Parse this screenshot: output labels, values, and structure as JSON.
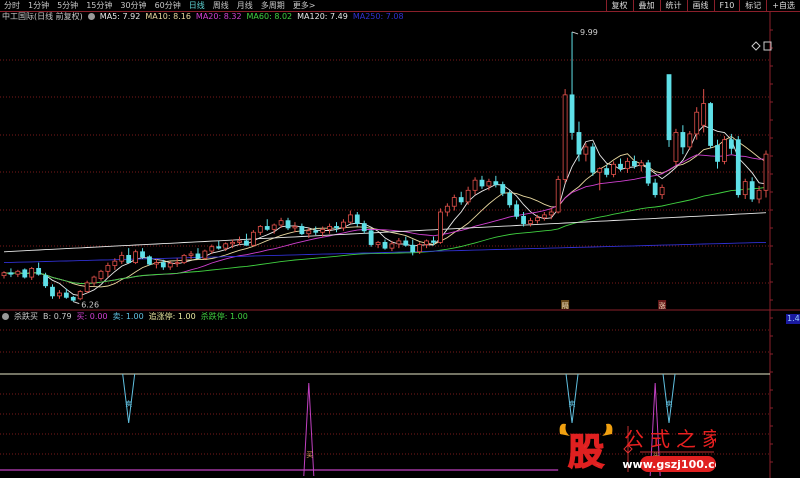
{
  "tabs": [
    "分时",
    "1分钟",
    "5分钟",
    "15分钟",
    "30分钟",
    "60分钟",
    "日线",
    "周线",
    "月线",
    "多周期",
    "更多>"
  ],
  "active_tab": "日线",
  "right_buttons": [
    "复权",
    "叠加",
    "统计",
    "画线",
    "F10",
    "标记",
    "+自选"
  ],
  "main": {
    "title": "中工国际(日线 前复权)",
    "ma": [
      {
        "label": "MA5: 7.92",
        "color": "#e8e8e8"
      },
      {
        "label": "MA10: 8.16",
        "color": "#e8d8a0"
      },
      {
        "label": "MA20: 8.32",
        "color": "#d040d0"
      },
      {
        "label": "MA60: 8.02",
        "color": "#40d040"
      },
      {
        "label": "MA120: 7.49",
        "color": "#e8e8e8"
      },
      {
        "label": "MA250: 7.08",
        "color": "#3030d0"
      }
    ],
    "high_label": "9.99",
    "low_label": "6.26",
    "markers": [
      {
        "bar": 81,
        "text": "隔"
      },
      {
        "bar": 95,
        "text": "涨"
      }
    ]
  },
  "indicator": {
    "name": "杀跌买",
    "values": [
      {
        "label": "B: 0.79",
        "color": "#c8c8c8"
      },
      {
        "label": "买: 0.00",
        "color": "#d040d0"
      },
      {
        "label": "卖: 1.00",
        "color": "#60c0e0"
      },
      {
        "label": "追涨停: 1.00",
        "color": "#e8e8a0"
      },
      {
        "label": "杀跌停: 1.00",
        "color": "#40d040"
      }
    ],
    "axis_label": "1.4",
    "sell_bars": [
      18,
      82,
      96
    ],
    "buy_bars": [
      44,
      94
    ],
    "sell_text": "卖",
    "buy_text": "买"
  },
  "colors": {
    "up": "#e0504a",
    "down": "#5fe0e8",
    "grid": "#7a1a1a",
    "bg": "#000000"
  },
  "watermark": {
    "logo": "股",
    "name": "公式之家",
    "url": "www.gszj100.com"
  },
  "chart_data": {
    "type": "candlestick",
    "ylim": [
      6.2,
      10.1
    ],
    "ohlc": [
      [
        6.62,
        6.68,
        6.58,
        6.66
      ],
      [
        6.66,
        6.72,
        6.6,
        6.64
      ],
      [
        6.64,
        6.7,
        6.6,
        6.68
      ],
      [
        6.7,
        6.72,
        6.58,
        6.6
      ],
      [
        6.6,
        6.74,
        6.56,
        6.72
      ],
      [
        6.72,
        6.8,
        6.62,
        6.64
      ],
      [
        6.62,
        6.66,
        6.45,
        6.48
      ],
      [
        6.46,
        6.5,
        6.3,
        6.34
      ],
      [
        6.34,
        6.42,
        6.3,
        6.38
      ],
      [
        6.38,
        6.44,
        6.3,
        6.32
      ],
      [
        6.32,
        6.34,
        6.26,
        6.28
      ],
      [
        6.3,
        6.42,
        6.28,
        6.4
      ],
      [
        6.4,
        6.55,
        6.38,
        6.52
      ],
      [
        6.52,
        6.62,
        6.48,
        6.6
      ],
      [
        6.58,
        6.7,
        6.55,
        6.68
      ],
      [
        6.68,
        6.8,
        6.6,
        6.76
      ],
      [
        6.76,
        6.86,
        6.7,
        6.82
      ],
      [
        6.82,
        6.95,
        6.78,
        6.9
      ],
      [
        6.9,
        7.0,
        6.85,
        6.8
      ],
      [
        6.8,
        6.98,
        6.78,
        6.95
      ],
      [
        6.95,
        7.0,
        6.85,
        6.88
      ],
      [
        6.88,
        6.9,
        6.76,
        6.78
      ],
      [
        6.78,
        6.85,
        6.72,
        6.8
      ],
      [
        6.8,
        6.84,
        6.7,
        6.74
      ],
      [
        6.74,
        6.82,
        6.7,
        6.79
      ],
      [
        6.79,
        6.86,
        6.74,
        6.8
      ],
      [
        6.8,
        6.92,
        6.78,
        6.9
      ],
      [
        6.9,
        6.96,
        6.85,
        6.92
      ],
      [
        6.92,
        7.0,
        6.88,
        6.86
      ],
      [
        6.86,
        6.98,
        6.84,
        6.96
      ],
      [
        6.96,
        7.05,
        6.92,
        7.02
      ],
      [
        7.02,
        7.1,
        6.98,
        7.0
      ],
      [
        7.0,
        7.08,
        6.96,
        7.06
      ],
      [
        7.06,
        7.12,
        7.0,
        7.08
      ],
      [
        7.08,
        7.16,
        7.04,
        7.1
      ],
      [
        7.1,
        7.2,
        7.06,
        7.04
      ],
      [
        7.04,
        7.25,
        7.02,
        7.22
      ],
      [
        7.22,
        7.32,
        7.18,
        7.3
      ],
      [
        7.3,
        7.4,
        7.24,
        7.26
      ],
      [
        7.26,
        7.34,
        7.2,
        7.32
      ],
      [
        7.32,
        7.42,
        7.28,
        7.38
      ],
      [
        7.38,
        7.42,
        7.25,
        7.28
      ],
      [
        7.28,
        7.36,
        7.22,
        7.3
      ],
      [
        7.3,
        7.34,
        7.18,
        7.2
      ],
      [
        7.2,
        7.28,
        7.14,
        7.24
      ],
      [
        7.24,
        7.3,
        7.18,
        7.22
      ],
      [
        7.22,
        7.3,
        7.16,
        7.26
      ],
      [
        7.26,
        7.34,
        7.2,
        7.3
      ],
      [
        7.3,
        7.36,
        7.22,
        7.28
      ],
      [
        7.28,
        7.4,
        7.24,
        7.36
      ],
      [
        7.36,
        7.52,
        7.34,
        7.46
      ],
      [
        7.46,
        7.5,
        7.3,
        7.34
      ],
      [
        7.34,
        7.38,
        7.2,
        7.24
      ],
      [
        7.24,
        7.26,
        7.02,
        7.05
      ],
      [
        7.05,
        7.1,
        7.0,
        7.08
      ],
      [
        7.08,
        7.12,
        6.98,
        7.0
      ],
      [
        7.0,
        7.1,
        6.96,
        7.06
      ],
      [
        7.06,
        7.14,
        7.0,
        7.1
      ],
      [
        7.1,
        7.16,
        7.02,
        7.04
      ],
      [
        7.04,
        7.12,
        6.9,
        6.95
      ],
      [
        6.95,
        7.08,
        6.92,
        7.05
      ],
      [
        7.05,
        7.12,
        7.0,
        7.1
      ],
      [
        7.1,
        7.16,
        7.04,
        7.08
      ],
      [
        7.08,
        7.55,
        7.06,
        7.5
      ],
      [
        7.5,
        7.62,
        7.44,
        7.58
      ],
      [
        7.58,
        7.74,
        7.52,
        7.7
      ],
      [
        7.7,
        7.78,
        7.6,
        7.64
      ],
      [
        7.64,
        7.85,
        7.6,
        7.8
      ],
      [
        7.8,
        7.98,
        7.74,
        7.94
      ],
      [
        7.94,
        8.0,
        7.82,
        7.86
      ],
      [
        7.86,
        7.96,
        7.8,
        7.92
      ],
      [
        7.92,
        8.0,
        7.84,
        7.88
      ],
      [
        7.88,
        7.92,
        7.72,
        7.76
      ],
      [
        7.76,
        7.8,
        7.56,
        7.6
      ],
      [
        7.6,
        7.66,
        7.4,
        7.44
      ],
      [
        7.44,
        7.5,
        7.3,
        7.34
      ],
      [
        7.34,
        7.42,
        7.3,
        7.38
      ],
      [
        7.38,
        7.46,
        7.34,
        7.42
      ],
      [
        7.42,
        7.5,
        7.38,
        7.46
      ],
      [
        7.46,
        7.55,
        7.4,
        7.5
      ],
      [
        7.5,
        8.0,
        7.48,
        7.95
      ],
      [
        7.95,
        9.2,
        7.9,
        9.12
      ],
      [
        9.12,
        9.99,
        8.5,
        8.6
      ],
      [
        8.6,
        8.75,
        8.2,
        8.3
      ],
      [
        8.3,
        8.45,
        8.2,
        8.4
      ],
      [
        8.4,
        8.45,
        8.0,
        8.05
      ],
      [
        8.05,
        8.12,
        7.8,
        8.1
      ],
      [
        8.1,
        8.15,
        7.98,
        8.02
      ],
      [
        8.02,
        8.2,
        7.98,
        8.16
      ],
      [
        8.16,
        8.24,
        8.06,
        8.1
      ],
      [
        8.1,
        8.25,
        8.04,
        8.2
      ],
      [
        8.2,
        8.28,
        8.1,
        8.14
      ],
      [
        8.14,
        8.22,
        8.06,
        8.18
      ],
      [
        8.18,
        8.22,
        7.86,
        7.9
      ],
      [
        7.9,
        7.96,
        7.7,
        7.74
      ],
      [
        7.74,
        7.88,
        7.68,
        7.84
      ],
      [
        9.4,
        9.4,
        8.4,
        8.5
      ],
      [
        8.2,
        8.65,
        8.15,
        8.6
      ],
      [
        8.6,
        8.7,
        8.3,
        8.4
      ],
      [
        8.4,
        8.62,
        8.36,
        8.58
      ],
      [
        8.58,
        8.95,
        8.5,
        8.88
      ],
      [
        8.7,
        9.2,
        8.6,
        9.0
      ],
      [
        9.0,
        9.02,
        8.38,
        8.42
      ],
      [
        8.42,
        8.5,
        8.1,
        8.2
      ],
      [
        8.2,
        8.55,
        8.16,
        8.5
      ],
      [
        8.5,
        8.58,
        8.3,
        8.38
      ],
      [
        8.5,
        8.55,
        7.7,
        7.74
      ],
      [
        7.74,
        7.96,
        7.68,
        7.92
      ],
      [
        7.92,
        7.98,
        7.64,
        7.68
      ],
      [
        7.68,
        7.86,
        7.62,
        7.8
      ],
      [
        7.8,
        8.35,
        7.7,
        8.3
      ]
    ]
  }
}
